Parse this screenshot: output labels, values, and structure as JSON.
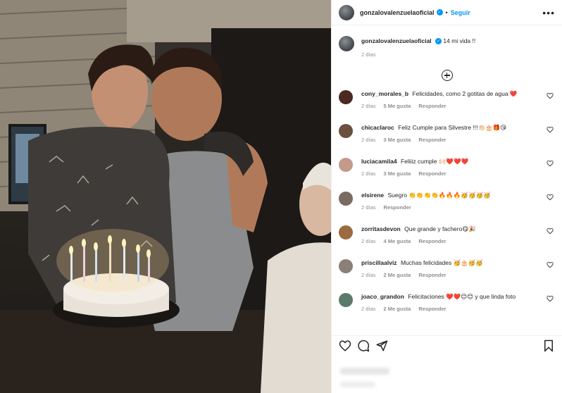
{
  "post": {
    "username": "gonzalovalenzuelaoficial",
    "follow_label": "Seguir",
    "dot": "•",
    "more_icon": "more-horizontal-icon",
    "caption": "14 mi vida !!",
    "caption_time": "2 días"
  },
  "comments": [
    {
      "user": "cony_morales_b",
      "text": "Felicidades, como 2 gotitas de agua ❤️",
      "time": "2 días",
      "likes": "5 Me gusta",
      "reply": "Responder",
      "avatar_color": "#4a2a22"
    },
    {
      "user": "chicaclaroc",
      "text": "Feliz Cumple para Silvestre !!!👏🏻🎂🎁😘",
      "time": "2 días",
      "likes": "3 Me gusta",
      "reply": "Responder",
      "avatar_color": "#6b5040"
    },
    {
      "user": "luciacamila4",
      "text": "Feliiiz cumple 🙌🏻❤️❤️❤️",
      "time": "2 días",
      "likes": "3 Me gusta",
      "reply": "Responder",
      "avatar_color": "#c49a8a"
    },
    {
      "user": "elsirene",
      "text": "Suegro 👏👏👏👏🔥🔥🔥🥳🥳🥳🥳",
      "time": "2 días",
      "likes": "",
      "reply": "Responder",
      "avatar_color": "#7a6a60"
    },
    {
      "user": "zorritasdevon",
      "text": "Que grande y fachero😋🎉",
      "time": "2 días",
      "likes": "4 Me gusta",
      "reply": "Responder",
      "avatar_color": "#9a6a40"
    },
    {
      "user": "priscillaalviz",
      "text": "Muchas felicidades 🥳🎂🥳🥳",
      "time": "2 días",
      "likes": "2 Me gusta",
      "reply": "Responder",
      "avatar_color": "#8a8078"
    },
    {
      "user": "joaco_grandon",
      "text": "Felicitaciones ❤️❤️😊😊 y que linda foto",
      "time": "2 días",
      "likes": "2 Me gusta",
      "reply": "Responder",
      "avatar_color": "#5a7a6a"
    }
  ],
  "colors": {
    "accent": "#0095f6",
    "muted": "#8e8e8e",
    "text": "#262626",
    "heart": "#ed4956"
  }
}
